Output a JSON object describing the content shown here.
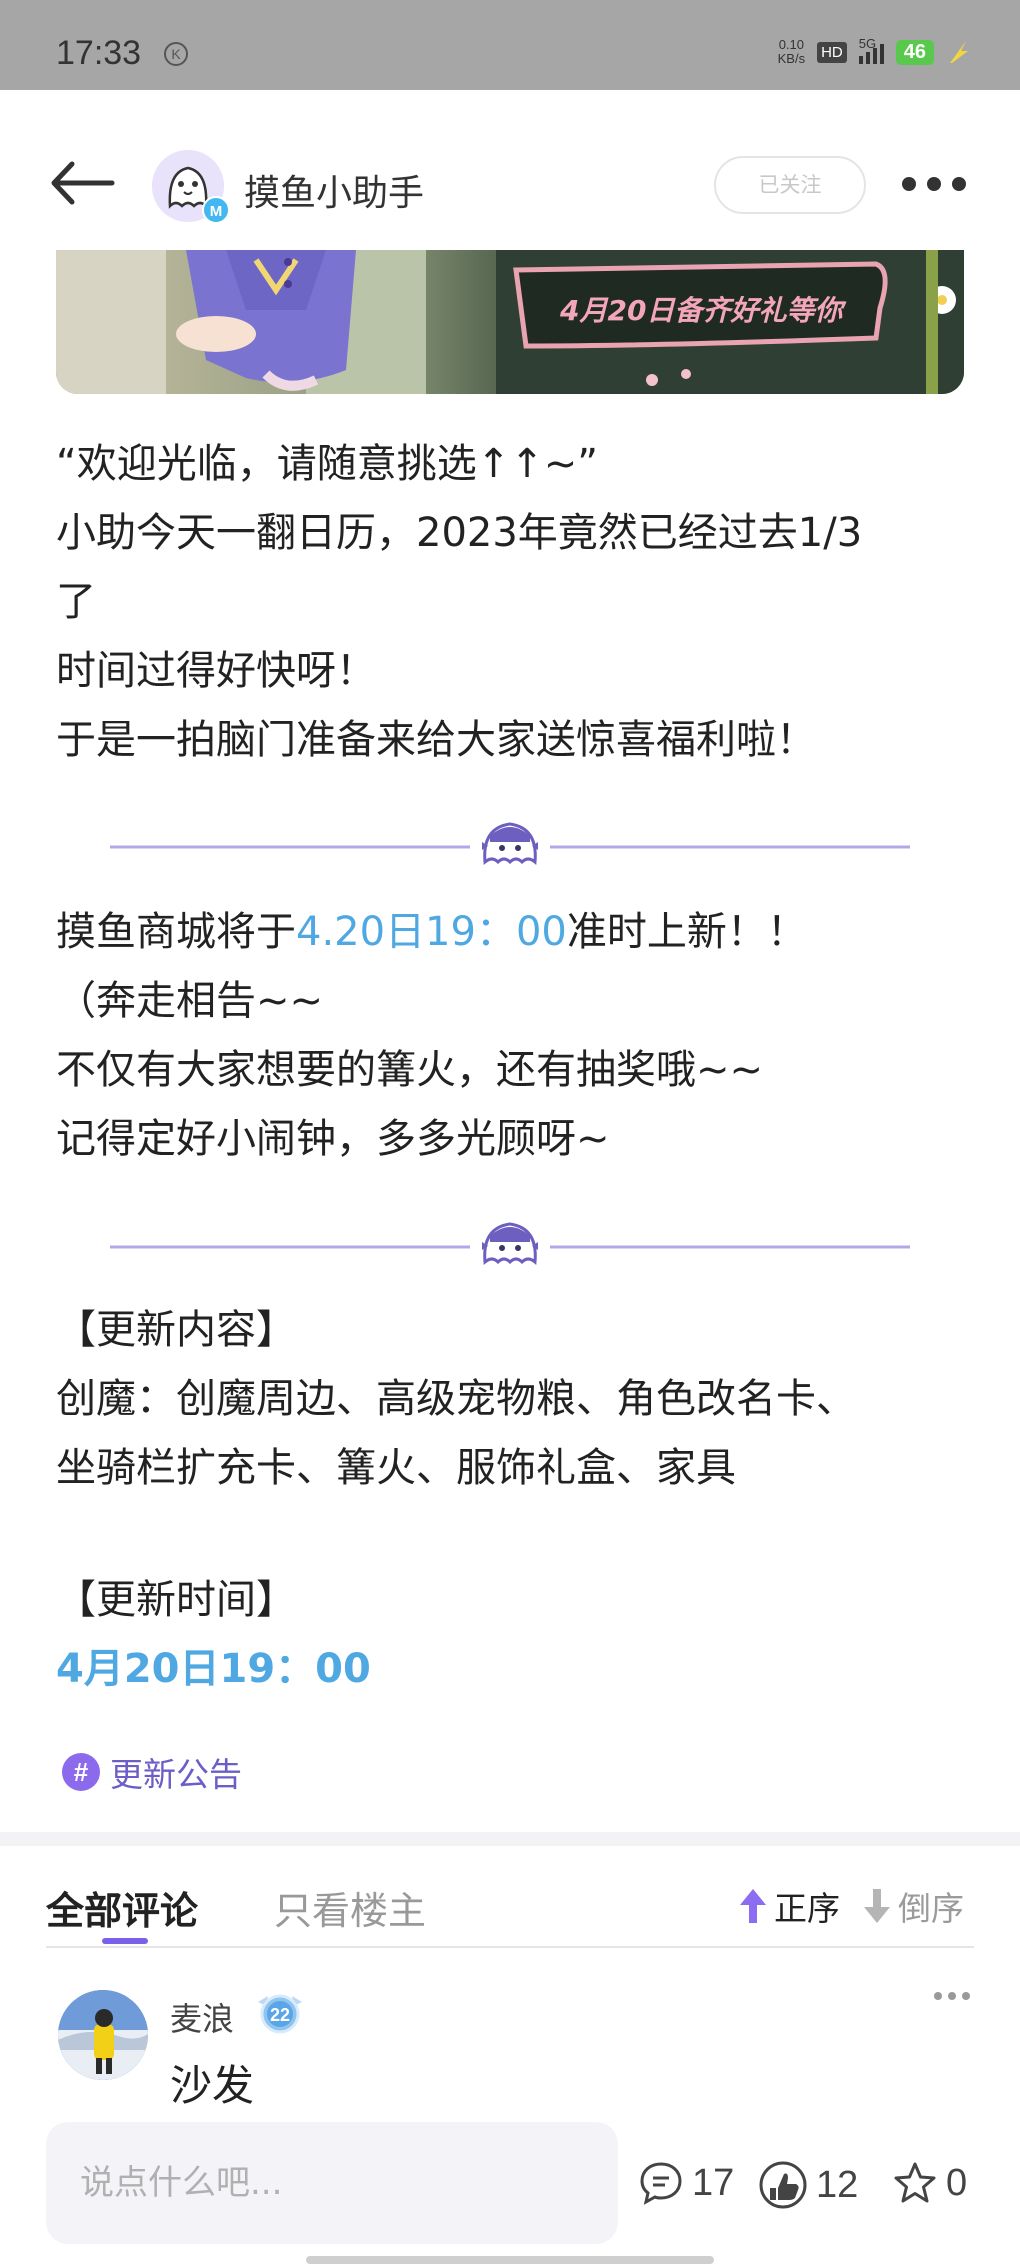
{
  "status_bar": {
    "time": "17:33",
    "k_icon": "K",
    "net_speed_value": "0.10",
    "net_speed_unit": "KB/s",
    "hd": "HD",
    "network": "5G",
    "battery": "46"
  },
  "header": {
    "title": "摸鱼小助手",
    "avatar_badge": "M",
    "follow_label": "已关注"
  },
  "banner": {
    "text": "4月20日备齐好礼等你"
  },
  "article": {
    "p1": [
      "“欢迎光临，请随意挑选↑↑~”",
      "小助今天一翻日历，2023年竟然已经过去1/3",
      "了",
      "时间过得好快呀！",
      "于是一拍脑门准备来给大家送惊喜福利啦！"
    ],
    "p2_prefix": "摸鱼商城将于",
    "p2_highlight": "4.20日19：00",
    "p2_suffix": "准时上新！！",
    "p2_lines": [
      "（奔走相告~~",
      "不仅有大家想要的篝火，还有抽奖哦~~",
      "记得定好小闹钟，多多光顾呀~"
    ],
    "section1_title": "【更新内容】",
    "section1_lines": [
      "创魔：创魔周边、高级宠物粮、角色改名卡、",
      "坐骑栏扩充卡、篝火、服饰礼盒、家具"
    ],
    "section2_title": "【更新时间】",
    "section2_value": "4月20日19：00"
  },
  "tag": {
    "icon": "#",
    "label": "更新公告"
  },
  "comments_section": {
    "tab_all": "全部评论",
    "tab_owner": "只看楼主",
    "sort_asc": "正序",
    "sort_desc": "倒序"
  },
  "comment": {
    "user": "麦浪",
    "level": "22",
    "text": "沙发"
  },
  "bottom_bar": {
    "input_placeholder": "说点什么吧...",
    "comments_count": "17",
    "likes_count": "12",
    "favorites_count": "0"
  },
  "colors": {
    "accent": "#7b61e8",
    "highlight": "#4fa8e2",
    "status_bar_bg": "#a6a6a6"
  }
}
